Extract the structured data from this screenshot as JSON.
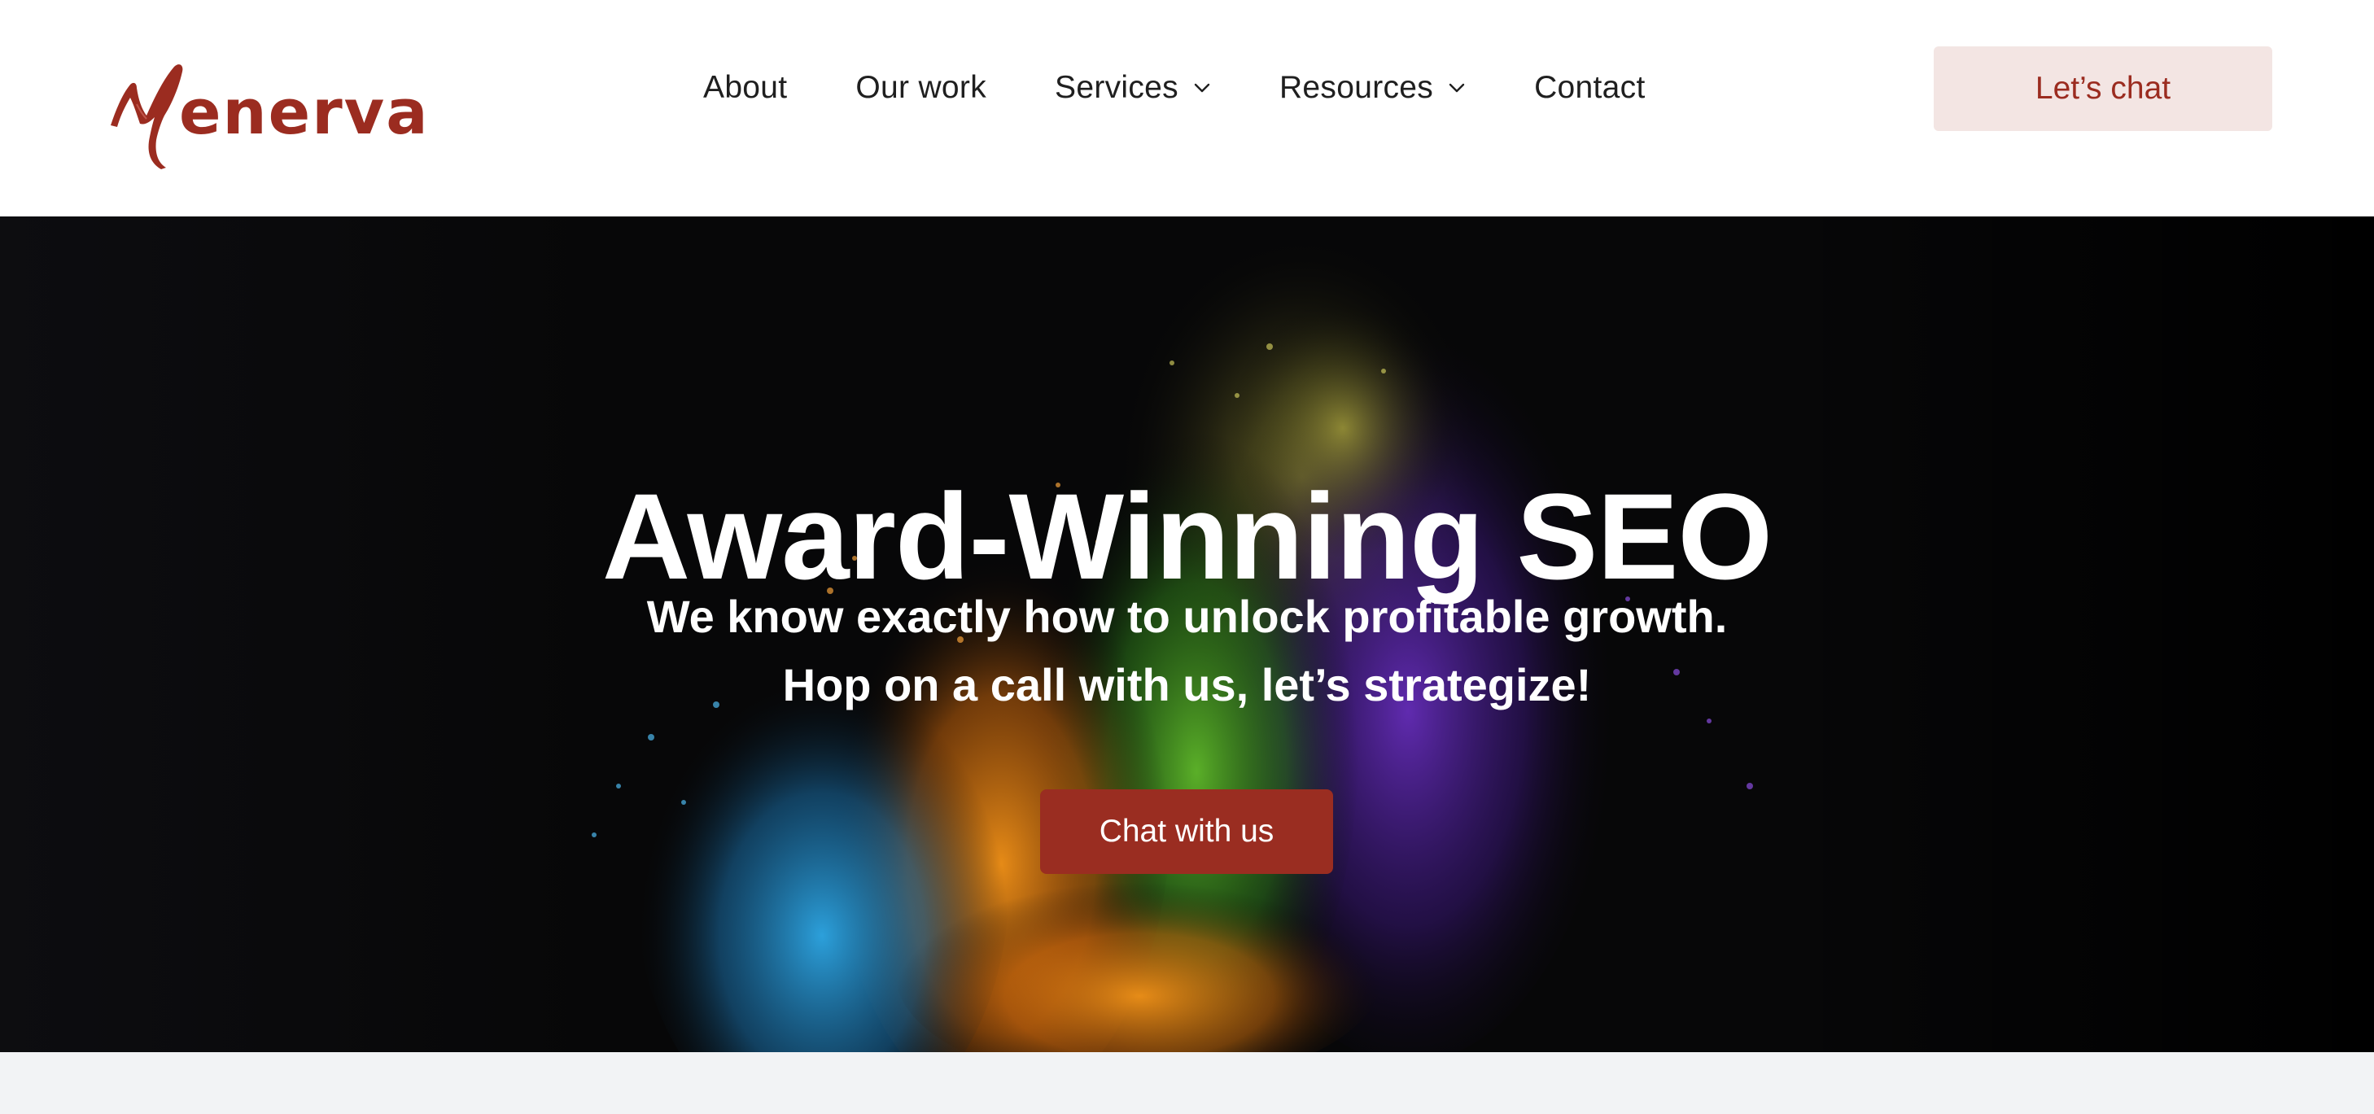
{
  "brand": {
    "logo_text": "Menerva",
    "brand_color": "#9b2c20"
  },
  "nav": {
    "items": [
      {
        "label": "About",
        "has_dropdown": false
      },
      {
        "label": "Our work",
        "has_dropdown": false
      },
      {
        "label": "Services",
        "has_dropdown": true,
        "icon": "chevron-down-icon"
      },
      {
        "label": "Resources",
        "has_dropdown": true,
        "icon": "chevron-down-icon"
      },
      {
        "label": "Contact",
        "has_dropdown": false
      }
    ],
    "cta_label": "Let’s chat"
  },
  "hero": {
    "title": "Award-Winning SEO",
    "subtitle_line1": "We know exactly how to unlock profitable growth.",
    "subtitle_line2": "Hop on a call with us, let’s strategize!",
    "cta_label": "Chat with us",
    "cta_color": "#9a2d21",
    "background": "colorful powder explosion on black"
  },
  "colors": {
    "header_bg": "#ffffff",
    "hero_bg": "#050506",
    "below_hero_bg": "#f2f3f5",
    "cta_top_bg": "#f3e5e3"
  }
}
